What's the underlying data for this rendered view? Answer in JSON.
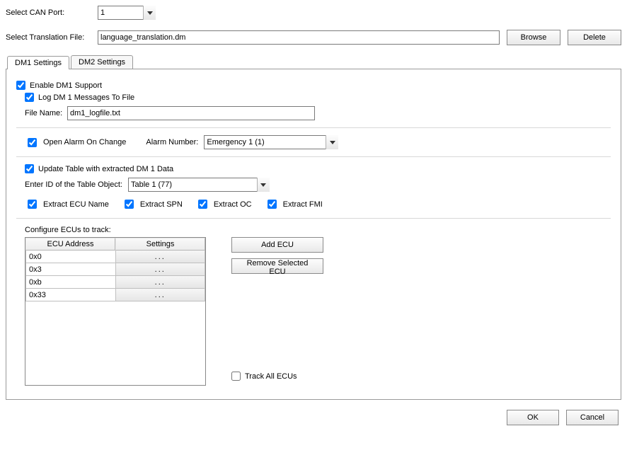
{
  "top": {
    "can_port_label": "Select CAN Port:",
    "can_port_value": "1",
    "translation_label": "Select Translation File:",
    "translation_value": "language_translation.dm",
    "browse": "Browse",
    "delete": "Delete"
  },
  "tabs": {
    "dm1": "DM1 Settings",
    "dm2": "DM2 Settings"
  },
  "dm1": {
    "enable": "Enable DM1 Support",
    "log_to_file": "Log DM 1 Messages To File",
    "file_name_label": "File Name:",
    "file_name_value": "dm1_logfile.txt",
    "open_alarm": "Open Alarm On Change",
    "alarm_number_label": "Alarm Number:",
    "alarm_number_value": "Emergency 1 (1)",
    "update_table": "Update Table with extracted DM 1 Data",
    "table_id_label": "Enter ID of the Table Object:",
    "table_id_value": "Table 1 (77)",
    "extract_ecu": "Extract ECU Name",
    "extract_spn": "Extract SPN",
    "extract_oc": "Extract OC",
    "extract_fmi": "Extract FMI",
    "configure_label": "Configure ECUs to track:",
    "col_ecu": "ECU Address",
    "col_settings": "Settings",
    "settings_btn": "...",
    "ecus": [
      "0x0",
      "0x3",
      "0xb",
      "0x33"
    ],
    "add_ecu": "Add ECU",
    "remove_ecu": "Remove Selected ECU",
    "track_all": "Track All ECUs"
  },
  "footer": {
    "ok": "OK",
    "cancel": "Cancel"
  }
}
